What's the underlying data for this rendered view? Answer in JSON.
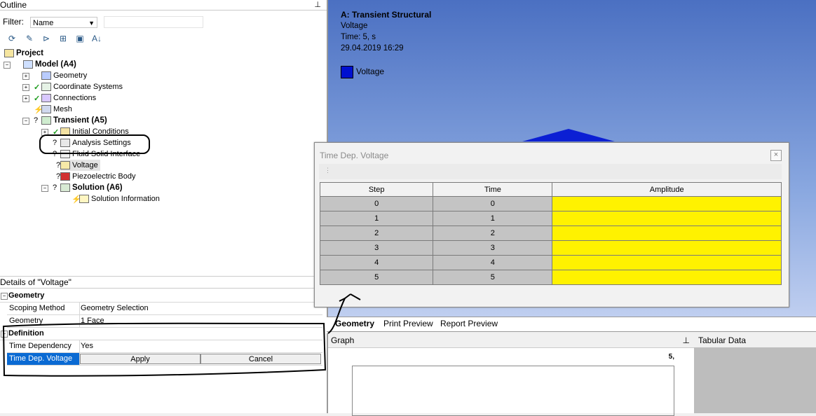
{
  "outline": {
    "title": "Outline",
    "pin": "📌",
    "filter_label": "Filter:",
    "filter_value": "Name",
    "tree": [
      {
        "label": "Project",
        "bold": true
      },
      {
        "label": "Model (A4)",
        "bold": true
      },
      {
        "label": "Geometry"
      },
      {
        "label": "Coordinate Systems"
      },
      {
        "label": "Connections"
      },
      {
        "label": "Mesh"
      },
      {
        "label": "Transient (A5)",
        "bold": true
      },
      {
        "label": "Initial Conditions"
      },
      {
        "label": "Analysis Settings"
      },
      {
        "label": "Fluid Solid Interface"
      },
      {
        "label": "Voltage"
      },
      {
        "label": "Piezoelectric Body"
      },
      {
        "label": "Solution (A6)",
        "bold": true
      },
      {
        "label": "Solution Information"
      }
    ]
  },
  "details": {
    "title": "Details of \"Voltage\"",
    "group_geometry": "Geometry",
    "scoping_method_label": "Scoping Method",
    "scoping_method_value": "Geometry Selection",
    "geometry_label": "Geometry",
    "geometry_value": "1 Face",
    "group_definition": "Definition",
    "time_dependency_label": "Time Dependency",
    "time_dependency_value": "Yes",
    "time_dep_voltage_label": "Time Dep. Voltage",
    "apply_label": "Apply",
    "cancel_label": "Cancel"
  },
  "viewport": {
    "title": "A: Transient Structural",
    "line1": "Voltage",
    "line2": "Time: 5, s",
    "line3": "29.04.2019 16:29",
    "legend_label": "Voltage",
    "legend_color": "#0010d0"
  },
  "tabs": [
    "Geometry",
    "Print Preview",
    "Report Preview"
  ],
  "graph": {
    "title": "Graph",
    "value": "5,"
  },
  "tabular": {
    "title": "Tabular Data"
  },
  "dialog": {
    "title": "Time Dep. Voltage",
    "close": "×",
    "columns": [
      "Step",
      "Time",
      "Amplitude"
    ],
    "rows": [
      {
        "step": "0",
        "time": "0",
        "amplitude": ""
      },
      {
        "step": "1",
        "time": "1",
        "amplitude": ""
      },
      {
        "step": "2",
        "time": "2",
        "amplitude": ""
      },
      {
        "step": "3",
        "time": "3",
        "amplitude": ""
      },
      {
        "step": "4",
        "time": "4",
        "amplitude": ""
      },
      {
        "step": "5",
        "time": "5",
        "amplitude": ""
      }
    ]
  }
}
